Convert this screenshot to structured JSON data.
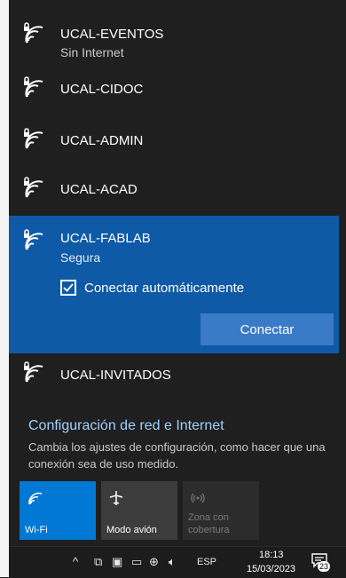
{
  "networks": [
    {
      "name": "UCAL-EVENTOS",
      "status": "Sin Internet",
      "icon": "wifi-secured-icon"
    },
    {
      "name": "UCAL-CIDOC",
      "icon": "wifi-secured-icon"
    },
    {
      "name": "UCAL-ADMIN",
      "icon": "wifi-secured-icon"
    },
    {
      "name": "UCAL-ACAD",
      "icon": "wifi-secured-icon"
    },
    {
      "name": "UCAL-FABLAB",
      "status": "Segura",
      "icon": "wifi-secured-icon",
      "selected": true
    },
    {
      "name": "UCAL-INVITADOS",
      "icon": "wifi-secured-icon"
    }
  ],
  "selected_network": {
    "auto_connect_label": "Conectar automáticamente",
    "auto_connect_checked": true,
    "connect_label": "Conectar"
  },
  "settings": {
    "link": "Configuración de red e Internet",
    "description": "Cambia los ajustes de configuración, como hacer que una conexión sea de uso medido."
  },
  "quick_actions": [
    {
      "label": "Wi-Fi",
      "icon": "wifi-icon",
      "state": "on"
    },
    {
      "label": "Modo avión",
      "icon": "airplane-icon",
      "state": "off"
    },
    {
      "label": "Zona con cobertura",
      "icon": "hotspot-icon",
      "state": "disabled"
    }
  ],
  "taskbar": {
    "language": "ESP",
    "time": "18:13",
    "date": "15/03/2023",
    "notification_count": "23"
  },
  "colors": {
    "background": "#1f1f1f",
    "selected": "#0e5aa7",
    "accent": "#0078d4",
    "link": "#9fd0ff"
  }
}
